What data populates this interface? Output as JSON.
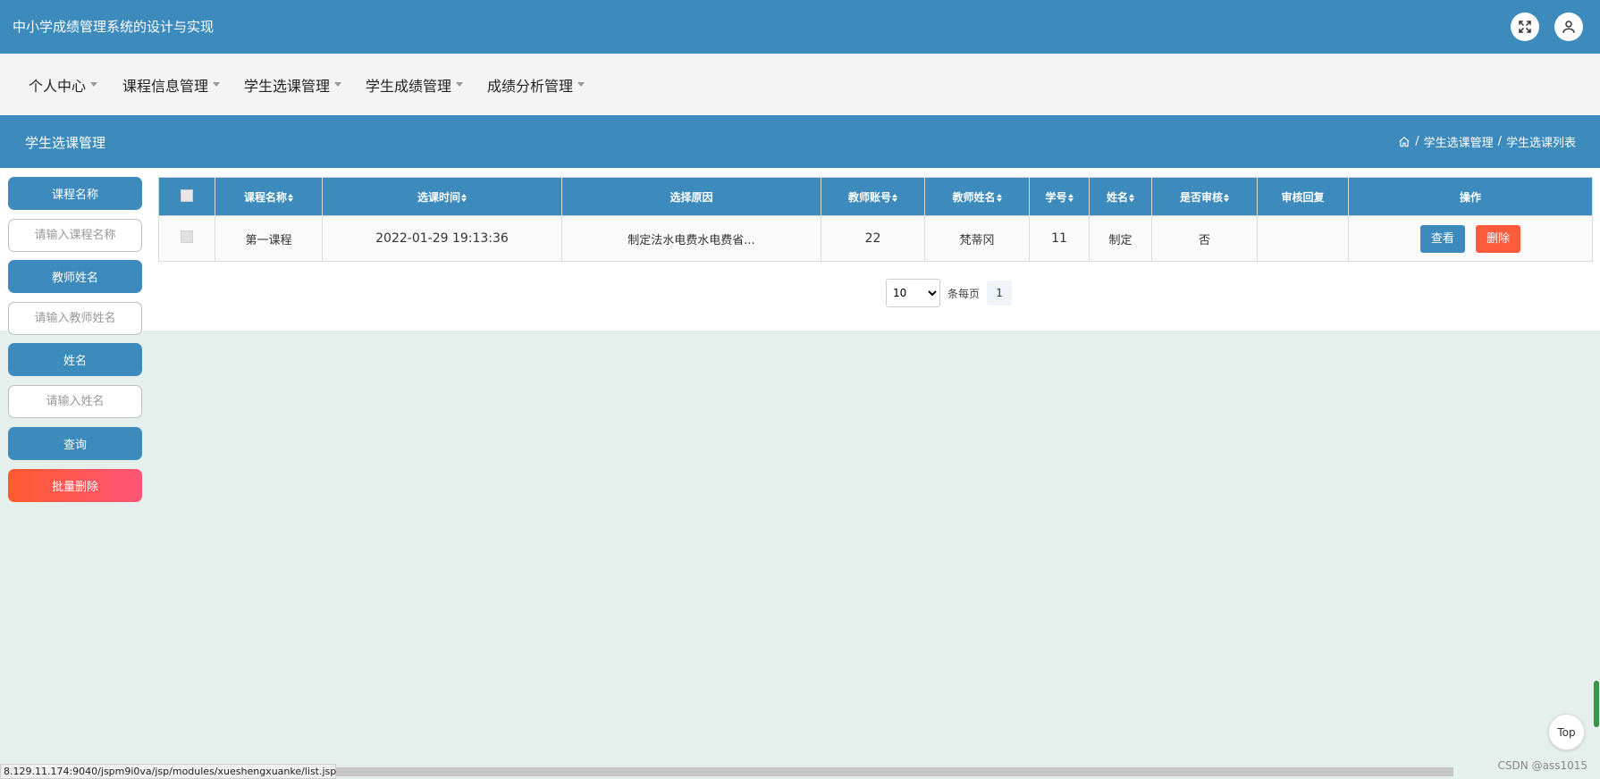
{
  "app_title": "中小学成绩管理系统的设计与实现",
  "top_icons": {
    "fullscreen": "fullscreen-icon",
    "user": "user-icon"
  },
  "nav": [
    {
      "label": "个人中心"
    },
    {
      "label": "课程信息管理"
    },
    {
      "label": "学生选课管理"
    },
    {
      "label": "学生成绩管理"
    },
    {
      "label": "成绩分析管理"
    }
  ],
  "page_title": "学生选课管理",
  "breadcrumb": {
    "home_icon": "home-icon",
    "sep": "/",
    "level1": "学生选课管理",
    "level2": "学生选课列表"
  },
  "search": {
    "course_label": "课程名称",
    "course_placeholder": "请输入课程名称",
    "teacher_label": "教师姓名",
    "teacher_placeholder": "请输入教师姓名",
    "name_label": "姓名",
    "name_placeholder": "请输入姓名",
    "query_button": "查询",
    "bulk_delete_button": "批量删除"
  },
  "table": {
    "headers": {
      "course": "课程名称",
      "time": "选课时间",
      "reason": "选择原因",
      "teacher_account": "教师账号",
      "teacher_name": "教师姓名",
      "student_id": "学号",
      "name": "姓名",
      "reviewed": "是否审核",
      "review_reply": "审核回复",
      "actions": "操作"
    },
    "rows": [
      {
        "course": "第一课程",
        "time": "2022-01-29 19:13:36",
        "reason": "制定法水电费水电费省...",
        "teacher_account": "22",
        "teacher_name": "梵蒂冈",
        "student_id": "11",
        "name": "制定",
        "reviewed": "否",
        "review_reply": "",
        "view": "查看",
        "delete": "删除"
      }
    ]
  },
  "pager": {
    "page_size": "10",
    "per_page_label": "条每页",
    "current_page": "1"
  },
  "top_button": "Top",
  "status_url": "8.129.11.174:9040/jspm9i0va/jsp/modules/xueshengxuanke/list.jsp#",
  "watermark": "CSDN @ass1015",
  "colors": {
    "primary": "#3d8abd",
    "danger": "#ff5a3c",
    "background": "#e5f0ec"
  }
}
